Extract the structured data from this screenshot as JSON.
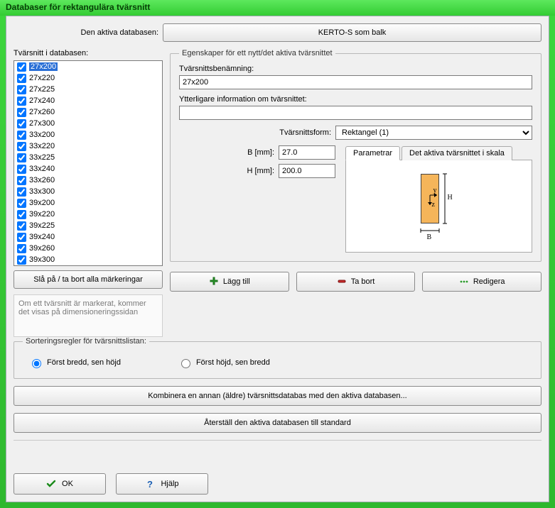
{
  "window": {
    "title": "Databaser för rektangulära tvärsnitt"
  },
  "active_db": {
    "label": "Den aktiva databasen:",
    "value": "KERTO-S som balk"
  },
  "list": {
    "label": "Tvärsnitt i databasen:",
    "items": [
      {
        "label": "27x200",
        "checked": true,
        "selected": true
      },
      {
        "label": "27x220",
        "checked": true,
        "selected": false
      },
      {
        "label": "27x225",
        "checked": true,
        "selected": false
      },
      {
        "label": "27x240",
        "checked": true,
        "selected": false
      },
      {
        "label": "27x260",
        "checked": true,
        "selected": false
      },
      {
        "label": "27x300",
        "checked": true,
        "selected": false
      },
      {
        "label": "33x200",
        "checked": true,
        "selected": false
      },
      {
        "label": "33x220",
        "checked": true,
        "selected": false
      },
      {
        "label": "33x225",
        "checked": true,
        "selected": false
      },
      {
        "label": "33x240",
        "checked": true,
        "selected": false
      },
      {
        "label": "33x260",
        "checked": true,
        "selected": false
      },
      {
        "label": "33x300",
        "checked": true,
        "selected": false
      },
      {
        "label": "39x200",
        "checked": true,
        "selected": false
      },
      {
        "label": "39x220",
        "checked": true,
        "selected": false
      },
      {
        "label": "39x225",
        "checked": true,
        "selected": false
      },
      {
        "label": "39x240",
        "checked": true,
        "selected": false
      },
      {
        "label": "39x260",
        "checked": true,
        "selected": false
      },
      {
        "label": "39x300",
        "checked": true,
        "selected": false
      }
    ],
    "toggle_all_btn": "Slå på / ta bort alla märkeringar",
    "hint": "Om ett tvärsnitt är markerat, kommer det visas på dimensioneringssidan"
  },
  "props": {
    "legend": "Egenskaper för ett nytt/det aktiva tvärsnittet",
    "name_label": "Tvärsnittsbenämning:",
    "name_value": "27x200",
    "extra_label": "Ytterligare information om tvärsnittet:",
    "extra_value": "",
    "form_label": "Tvärsnittsform:",
    "form_value": "Rektangel (1)",
    "b_label": "B [mm]:",
    "b_value": "27.0",
    "h_label": "H [mm]:",
    "h_value": "200.0",
    "tabs": {
      "parametrar": "Parametrar",
      "skala": "Det aktiva tvärsnittet i skala"
    },
    "preview": {
      "b": "B",
      "h": "H",
      "y": "y",
      "z": "z"
    }
  },
  "actions": {
    "add": "Lägg till",
    "remove": "Ta bort",
    "edit": "Redigera"
  },
  "sort": {
    "legend": "Sorteringsregler för tvärsnittslistan:",
    "opt1": "Först bredd, sen höjd",
    "opt2": "Först höjd, sen bredd"
  },
  "combine_btn": "Kombinera en annan (äldre) tvärsnittsdatabas med den aktiva databasen...",
  "reset_btn": "Återställ den aktiva databasen till standard",
  "footer": {
    "ok": "OK",
    "help": "Hjälp"
  }
}
